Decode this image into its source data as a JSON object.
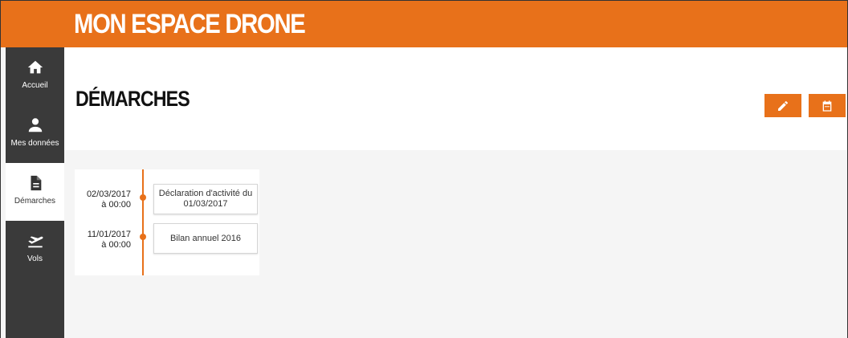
{
  "header": {
    "app_title": "MON ESPACE DRONE",
    "accent_color": "#e8711a"
  },
  "sidebar": {
    "items": [
      {
        "label": "Accueil",
        "icon": "home-icon",
        "active": false
      },
      {
        "label": "Mes données",
        "icon": "user-icon",
        "active": false
      },
      {
        "label": "Démarches",
        "icon": "document-icon",
        "active": true
      },
      {
        "label": "Vols",
        "icon": "airplane-takeoff-icon",
        "active": false
      }
    ]
  },
  "main": {
    "page_title": "DÉMARCHES",
    "actions": [
      {
        "icon": "pencil-icon"
      },
      {
        "icon": "calendar-icon"
      }
    ]
  },
  "timeline": {
    "entries": [
      {
        "date": "02/03/2017",
        "time": "à 00:00",
        "title": "Déclaration d'activité du 01/03/2017"
      },
      {
        "date": "11/01/2017",
        "time": "à 00:00",
        "title": "Bilan annuel 2016"
      }
    ]
  }
}
